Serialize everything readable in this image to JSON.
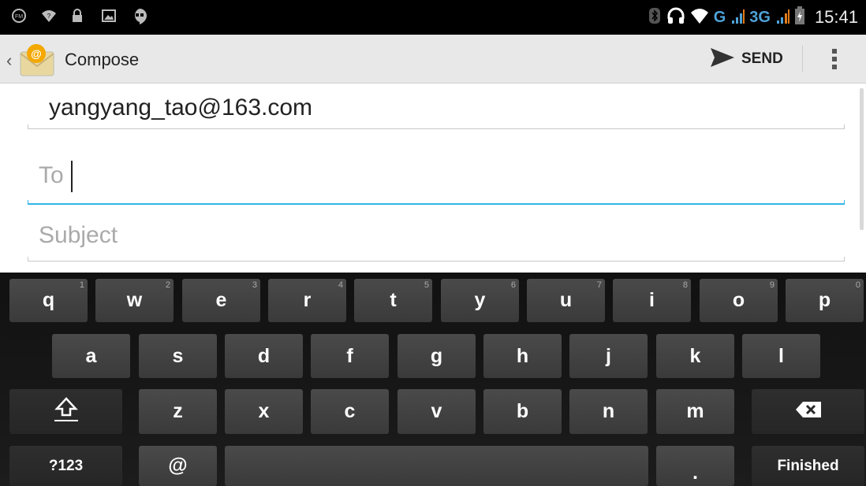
{
  "status_bar": {
    "left_icons": [
      "fm-radio-icon",
      "wifi-question-icon",
      "lock-icon",
      "image-icon",
      "hangouts-icon"
    ],
    "right": {
      "network_g": "G",
      "network_3g": "3G",
      "time": "15:41"
    }
  },
  "action_bar": {
    "title": "Compose",
    "send_label": "SEND"
  },
  "compose": {
    "from": "yangyang_tao@163.com",
    "to_placeholder": "To",
    "subject_placeholder": "Subject"
  },
  "keyboard": {
    "row1": [
      {
        "key": "q",
        "hint": "1"
      },
      {
        "key": "w",
        "hint": "2"
      },
      {
        "key": "e",
        "hint": "3"
      },
      {
        "key": "r",
        "hint": "4"
      },
      {
        "key": "t",
        "hint": "5"
      },
      {
        "key": "y",
        "hint": "6"
      },
      {
        "key": "u",
        "hint": "7"
      },
      {
        "key": "i",
        "hint": "8"
      },
      {
        "key": "o",
        "hint": "9"
      },
      {
        "key": "p",
        "hint": "0"
      }
    ],
    "row2": [
      "a",
      "s",
      "d",
      "f",
      "g",
      "h",
      "j",
      "k",
      "l"
    ],
    "row3": [
      "z",
      "x",
      "c",
      "v",
      "b",
      "n",
      "m"
    ],
    "symbols_label": "?123",
    "at_label": "@",
    "period_label": ".",
    "finished_label": "Finished"
  },
  "colors": {
    "accent": "#33b5e5",
    "keyboard_bg": "#151515",
    "key_bg": "#434343"
  }
}
